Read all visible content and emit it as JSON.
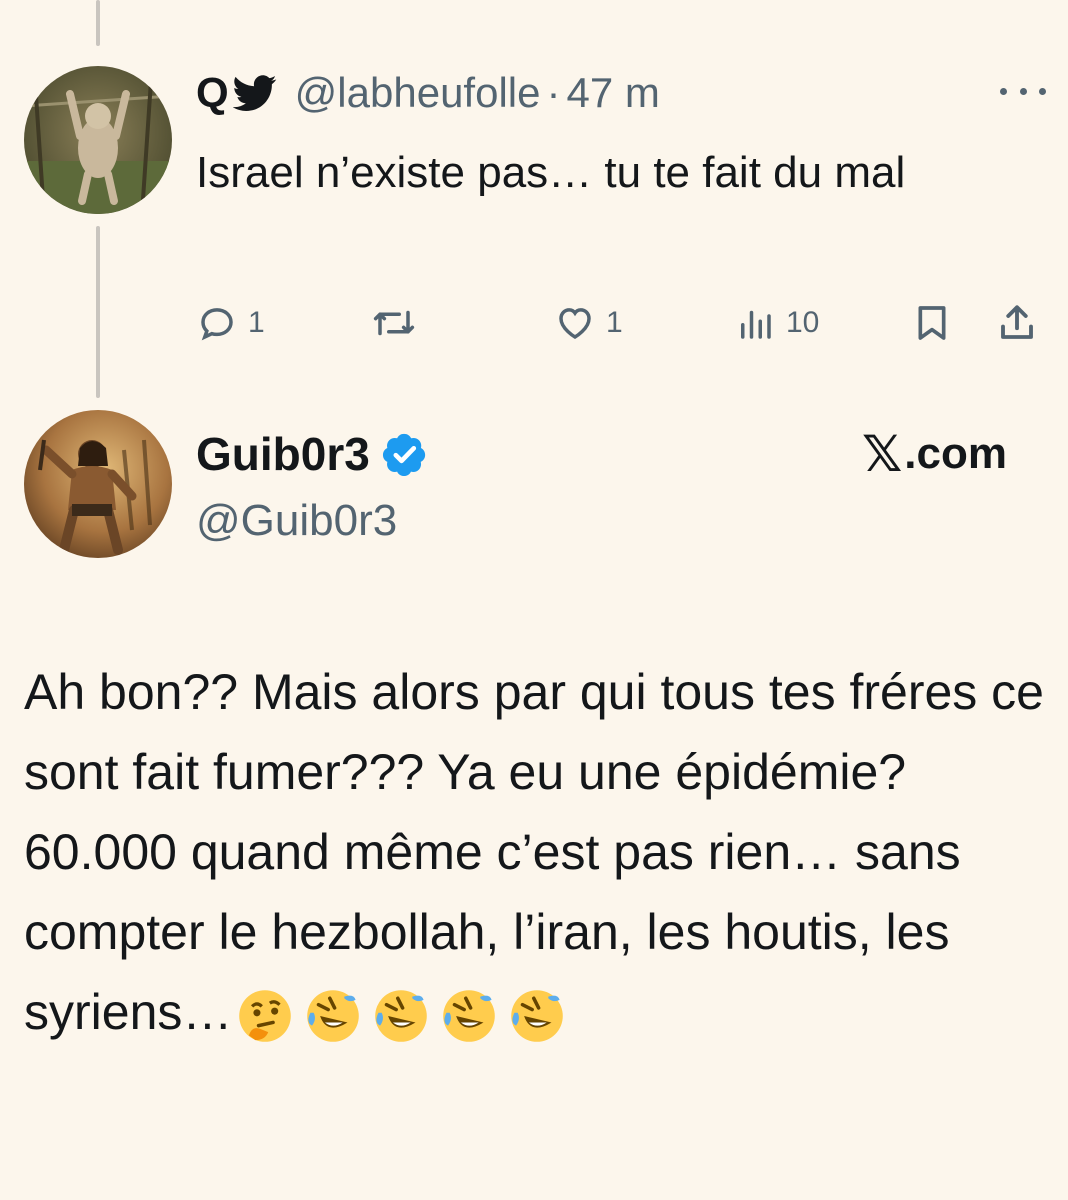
{
  "reply": {
    "name": "Q",
    "handle": "@labheufolle",
    "separator": "·",
    "time": "47 m",
    "text": "Israel n’existe pas… tu te fait du mal",
    "actions": {
      "reply_count": "1",
      "like_count": "1",
      "views_count": "10"
    },
    "icons": [
      "bird-icon",
      "more-icon",
      "reply-icon",
      "retweet-icon",
      "like-icon",
      "views-icon",
      "bookmark-icon",
      "share-icon"
    ]
  },
  "main": {
    "name": "Guib0r3",
    "handle": "@Guib0r3",
    "verified": true,
    "brand_x": "𝕏",
    "brand_suffix": ".com",
    "text_lines": [
      "Ah bon?? Mais alors par qui tous tes fréres ce sont fait fumer??? Ya eu une épidémie?",
      "60.000 quand même c’est pas rien… sans compter le hezbollah, l’iran, les houtis, les syriens…"
    ],
    "emojis": [
      "thinking-face",
      "rolling-on-floor-laughing",
      "rolling-on-floor-laughing",
      "rolling-on-floor-laughing",
      "rolling-on-floor-laughing"
    ]
  },
  "colors": {
    "background": "#fcf6ec",
    "text": "#14171a",
    "secondary_text": "#536471",
    "verified_blue": "#1d9bf0",
    "thread_line": "#c9c5bf"
  }
}
